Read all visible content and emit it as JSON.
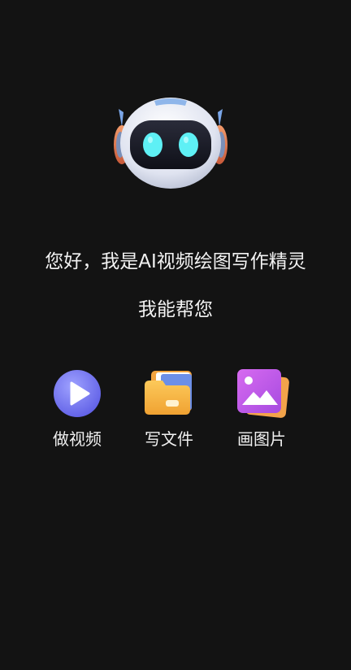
{
  "greeting": "您好，我是AI视频绘图写作精灵",
  "subtitle": "我能帮您",
  "actions": [
    {
      "label": "做视频",
      "icon": "play-video-icon"
    },
    {
      "label": "写文件",
      "icon": "folder-icon"
    },
    {
      "label": "画图片",
      "icon": "image-gallery-icon"
    }
  ],
  "colors": {
    "background": "#131313",
    "text": "#f2f2f2",
    "robot_eye": "#5ef0f5",
    "play_icon": "#7b7cf5",
    "folder_icon": "#f5b441",
    "image_icon": "#c25ae8"
  }
}
